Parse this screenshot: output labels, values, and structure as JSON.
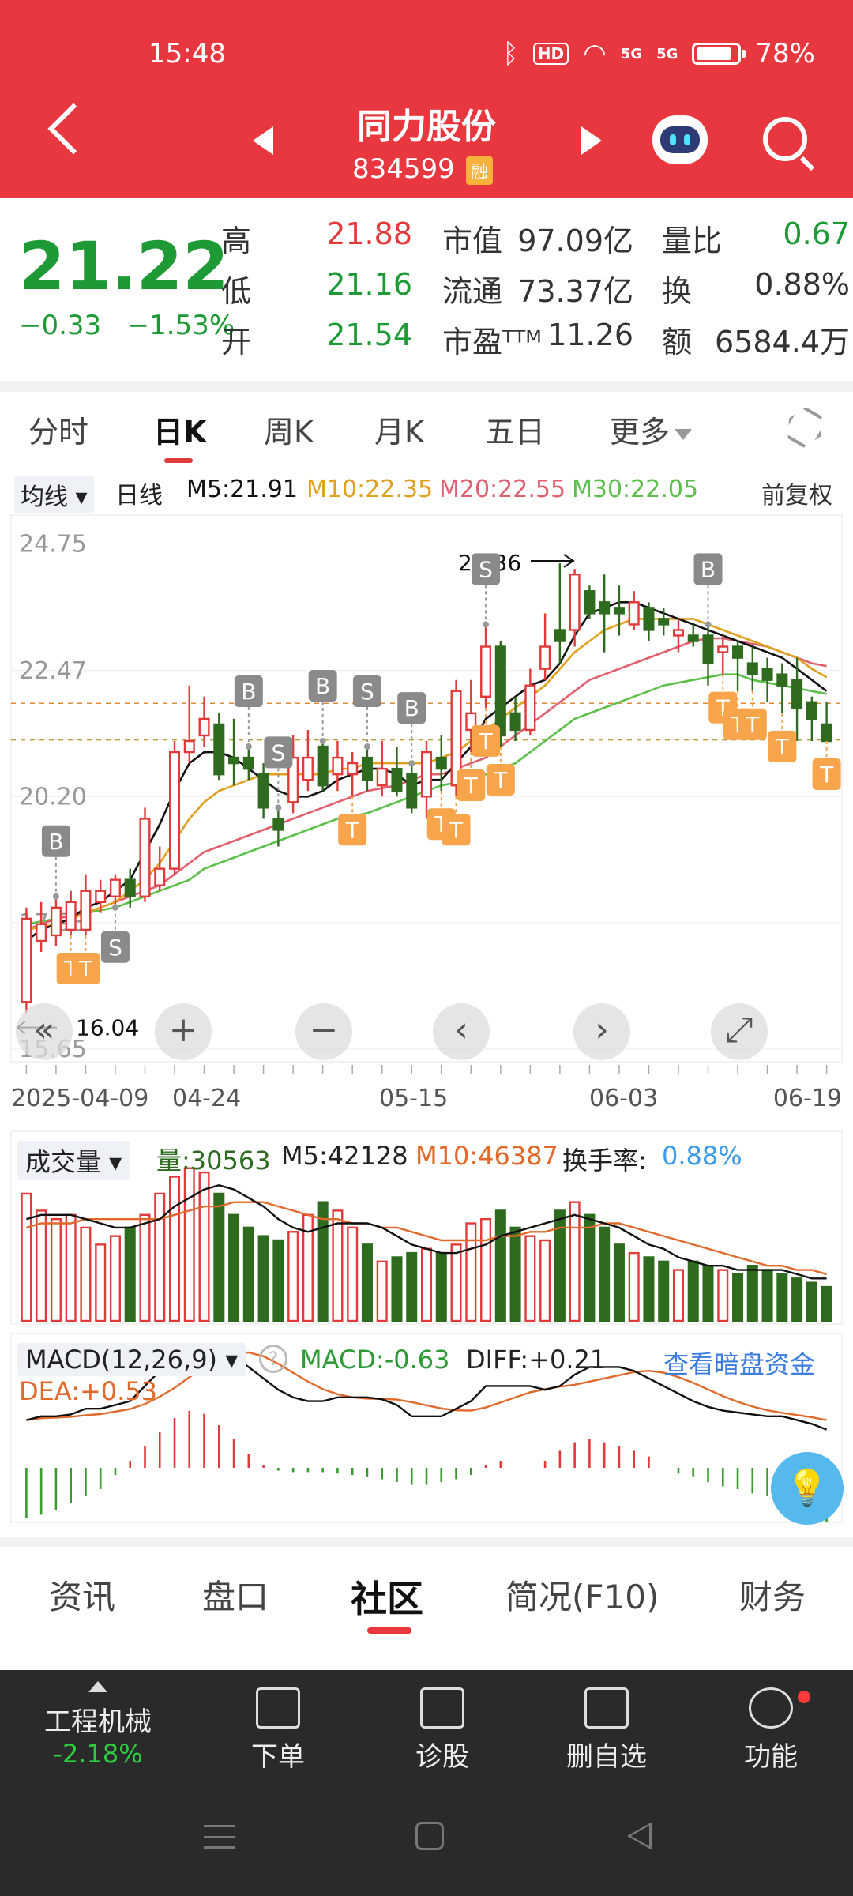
{
  "status_bar": {
    "time": "15:48",
    "hd": "HD",
    "sig1": "5G",
    "sig2": "5G",
    "battery": "78%"
  },
  "header": {
    "name": "同力股份",
    "code": "834599",
    "badge": "融"
  },
  "quote": {
    "price": "21.22",
    "change": "−0.33",
    "change_pct": "−1.53%",
    "rows": [
      {
        "l1": "高",
        "v1": "21.88",
        "l2": "市值",
        "v2": "97.09亿",
        "l3": "量比",
        "v3": "0.67"
      },
      {
        "l1": "低",
        "v1": "21.16",
        "l2": "流通",
        "v2": "73.37亿",
        "l3": "换",
        "v3": "0.88%"
      },
      {
        "l1": "开",
        "v1": "21.54",
        "l2": "市盈ᵀᵀᴹ",
        "v2": "11.26",
        "l3": "额",
        "v3": "6584.4万"
      }
    ]
  },
  "tabs": {
    "t1": "分时",
    "t2": "日K",
    "t3": "周K",
    "t4": "月K",
    "t5": "五日",
    "t6": "更多"
  },
  "legend": {
    "junxian": "均线 ▾",
    "rixian": "日线",
    "m5": "M5:21.91",
    "m10": "M10:22.35",
    "m20": "M20:22.55",
    "m30": "M30:22.05",
    "fq": "前复权"
  },
  "colors": {
    "red": "#e13a3a",
    "green": "#2e6b1f",
    "m5": "#111111",
    "m10": "#e0a020",
    "m20": "#e06070",
    "m30": "#5cbf4a",
    "marker_t": "#f7a44a",
    "marker_bs": "#8a8a8a"
  },
  "chart_data": {
    "type": "candlestick",
    "y_axis_labels": [
      "24.75",
      "22.47",
      "20.20",
      "17.93",
      "15.65"
    ],
    "high_label": "24.36",
    "low_label": "16.04",
    "x_labels": [
      "2025-04-09",
      "04-24",
      "05-15",
      "06-03",
      "06-19"
    ],
    "candles": [
      {
        "o": 16.5,
        "c": 18.0,
        "h": 18.2,
        "l": 16.3
      },
      {
        "o": 17.6,
        "c": 17.9,
        "h": 18.3,
        "l": 17.4
      },
      {
        "o": 17.7,
        "c": 18.2,
        "h": 18.4,
        "l": 17.5
      },
      {
        "o": 17.8,
        "c": 18.3,
        "h": 18.5,
        "l": 17.7
      },
      {
        "o": 17.8,
        "c": 18.5,
        "h": 18.8,
        "l": 17.7
      },
      {
        "o": 18.3,
        "c": 18.5,
        "h": 18.7,
        "l": 18.1
      },
      {
        "o": 18.4,
        "c": 18.7,
        "h": 18.8,
        "l": 18.2
      },
      {
        "o": 18.7,
        "c": 18.4,
        "h": 18.9,
        "l": 18.2
      },
      {
        "o": 18.4,
        "c": 19.8,
        "h": 20.0,
        "l": 18.3
      },
      {
        "o": 18.6,
        "c": 18.9,
        "h": 19.3,
        "l": 18.5
      },
      {
        "o": 18.9,
        "c": 21.0,
        "h": 21.2,
        "l": 18.8
      },
      {
        "o": 21.0,
        "c": 21.2,
        "h": 22.2,
        "l": 20.8
      },
      {
        "o": 21.3,
        "c": 21.6,
        "h": 22.0,
        "l": 21.1
      },
      {
        "o": 21.5,
        "c": 20.6,
        "h": 21.7,
        "l": 20.5
      },
      {
        "o": 20.9,
        "c": 20.8,
        "h": 21.6,
        "l": 20.4
      },
      {
        "o": 20.9,
        "c": 20.7,
        "h": 21.1,
        "l": 20.5
      },
      {
        "o": 20.6,
        "c": 20.0,
        "h": 20.8,
        "l": 19.8
      },
      {
        "o": 19.8,
        "c": 19.6,
        "h": 20.0,
        "l": 19.3
      },
      {
        "o": 20.1,
        "c": 20.9,
        "h": 21.3,
        "l": 19.9
      },
      {
        "o": 20.5,
        "c": 20.9,
        "h": 21.4,
        "l": 20.3
      },
      {
        "o": 21.1,
        "c": 20.4,
        "h": 21.2,
        "l": 20.3
      },
      {
        "o": 20.6,
        "c": 20.9,
        "h": 21.2,
        "l": 20.3
      },
      {
        "o": 20.6,
        "c": 20.8,
        "h": 21.0,
        "l": 20.2
      },
      {
        "o": 20.9,
        "c": 20.5,
        "h": 21.1,
        "l": 20.3
      },
      {
        "o": 20.4,
        "c": 20.7,
        "h": 21.2,
        "l": 20.2
      },
      {
        "o": 20.7,
        "c": 20.3,
        "h": 21.1,
        "l": 20.2
      },
      {
        "o": 20.6,
        "c": 20.0,
        "h": 20.8,
        "l": 19.9
      },
      {
        "o": 20.2,
        "c": 21.0,
        "h": 21.2,
        "l": 19.8
      },
      {
        "o": 20.9,
        "c": 20.7,
        "h": 21.3,
        "l": 20.3
      },
      {
        "o": 20.4,
        "c": 22.1,
        "h": 22.3,
        "l": 20.2
      },
      {
        "o": 21.4,
        "c": 21.7,
        "h": 22.3,
        "l": 21.0
      },
      {
        "o": 22.0,
        "c": 22.9,
        "h": 23.3,
        "l": 21.8
      },
      {
        "o": 22.9,
        "c": 21.3,
        "h": 23.0,
        "l": 21.1
      },
      {
        "o": 21.7,
        "c": 21.4,
        "h": 22.0,
        "l": 21.2
      },
      {
        "o": 21.4,
        "c": 22.2,
        "h": 22.5,
        "l": 21.3
      },
      {
        "o": 22.5,
        "c": 22.9,
        "h": 23.5,
        "l": 22.3
      },
      {
        "o": 23.2,
        "c": 23.0,
        "h": 24.4,
        "l": 22.6
      },
      {
        "o": 23.2,
        "c": 24.2,
        "h": 24.3,
        "l": 22.9
      },
      {
        "o": 23.9,
        "c": 23.5,
        "h": 24.0,
        "l": 23.4
      },
      {
        "o": 23.7,
        "c": 23.5,
        "h": 24.2,
        "l": 22.8
      },
      {
        "o": 23.6,
        "c": 23.5,
        "h": 24.0,
        "l": 23.1
      },
      {
        "o": 23.3,
        "c": 23.7,
        "h": 23.9,
        "l": 23.2
      },
      {
        "o": 23.6,
        "c": 23.2,
        "h": 23.7,
        "l": 23.0
      },
      {
        "o": 23.4,
        "c": 23.3,
        "h": 23.6,
        "l": 23.1
      },
      {
        "o": 23.1,
        "c": 23.2,
        "h": 23.4,
        "l": 22.8
      },
      {
        "o": 23.1,
        "c": 23.0,
        "h": 23.3,
        "l": 22.9
      },
      {
        "o": 23.1,
        "c": 22.6,
        "h": 23.3,
        "l": 22.2
      },
      {
        "o": 22.8,
        "c": 22.9,
        "h": 23.1,
        "l": 22.4
      },
      {
        "o": 22.9,
        "c": 22.7,
        "h": 23.0,
        "l": 22.1
      },
      {
        "o": 22.6,
        "c": 22.4,
        "h": 22.9,
        "l": 22.1
      },
      {
        "o": 22.5,
        "c": 22.3,
        "h": 22.7,
        "l": 21.9
      },
      {
        "o": 22.4,
        "c": 22.2,
        "h": 22.6,
        "l": 21.7
      },
      {
        "o": 22.3,
        "c": 21.8,
        "h": 22.7,
        "l": 21.2
      },
      {
        "o": 21.9,
        "c": 21.6,
        "h": 22.0,
        "l": 21.2
      },
      {
        "o": 21.5,
        "c": 21.2,
        "h": 21.9,
        "l": 21.2
      }
    ],
    "ma5": [
      17.6,
      17.8,
      17.9,
      18.0,
      18.2,
      18.3,
      18.5,
      18.7,
      19.2,
      19.7,
      20.3,
      20.8,
      21.0,
      21.0,
      20.9,
      20.7,
      20.5,
      20.3,
      20.2,
      20.2,
      20.3,
      20.5,
      20.6,
      20.7,
      20.7,
      20.6,
      20.4,
      20.5,
      20.5,
      20.8,
      21.1,
      21.6,
      21.8,
      22.0,
      22.2,
      22.3,
      22.6,
      23.1,
      23.5,
      23.6,
      23.7,
      23.7,
      23.6,
      23.5,
      23.4,
      23.3,
      23.2,
      23.1,
      23.0,
      22.9,
      22.8,
      22.7,
      22.5,
      22.3,
      22.1
    ],
    "ma10": [
      17.8,
      17.85,
      17.9,
      18.0,
      18.1,
      18.2,
      18.3,
      18.5,
      18.7,
      19.0,
      19.4,
      19.8,
      20.1,
      20.3,
      20.4,
      20.5,
      20.6,
      20.6,
      20.6,
      20.6,
      20.6,
      20.7,
      20.7,
      20.8,
      20.8,
      20.8,
      20.8,
      20.8,
      20.9,
      21.0,
      21.2,
      21.4,
      21.6,
      21.8,
      22.0,
      22.2,
      22.5,
      22.8,
      23.0,
      23.2,
      23.3,
      23.4,
      23.4,
      23.4,
      23.4,
      23.4,
      23.3,
      23.2,
      23.1,
      23.0,
      22.9,
      22.8,
      22.7,
      22.5,
      22.35
    ],
    "ma20": [
      17.8,
      17.9,
      18.0,
      18.05,
      18.1,
      18.2,
      18.3,
      18.4,
      18.5,
      18.6,
      18.8,
      19.0,
      19.2,
      19.3,
      19.4,
      19.5,
      19.6,
      19.7,
      19.8,
      19.9,
      20.0,
      20.1,
      20.2,
      20.3,
      20.35,
      20.4,
      20.5,
      20.6,
      20.6,
      20.7,
      20.8,
      20.9,
      21.1,
      21.3,
      21.5,
      21.7,
      21.9,
      22.1,
      22.3,
      22.4,
      22.5,
      22.6,
      22.7,
      22.8,
      22.9,
      23.0,
      23.05,
      23.05,
      23.0,
      22.95,
      22.9,
      22.8,
      22.7,
      22.6,
      22.55
    ],
    "ma30": [
      17.9,
      17.95,
      18.0,
      18.05,
      18.1,
      18.15,
      18.2,
      18.3,
      18.4,
      18.5,
      18.6,
      18.7,
      18.9,
      19.0,
      19.1,
      19.2,
      19.3,
      19.4,
      19.5,
      19.6,
      19.7,
      19.8,
      19.85,
      19.9,
      20.0,
      20.1,
      20.2,
      20.3,
      20.4,
      20.45,
      20.5,
      20.6,
      20.7,
      20.8,
      21.0,
      21.2,
      21.4,
      21.6,
      21.7,
      21.8,
      21.9,
      22.0,
      22.1,
      22.2,
      22.25,
      22.3,
      22.35,
      22.4,
      22.4,
      22.3,
      22.25,
      22.2,
      22.15,
      22.1,
      22.05
    ],
    "volume": [
      30,
      26,
      24,
      25,
      22,
      18,
      20,
      22,
      25,
      30,
      34,
      36,
      35,
      30,
      25,
      22,
      20,
      19,
      21,
      25,
      28,
      26,
      22,
      18,
      14,
      15,
      16,
      17,
      16,
      18,
      23,
      24,
      26,
      22,
      20,
      19,
      26,
      28,
      25,
      22,
      18,
      16,
      15,
      14,
      12,
      14,
      13,
      12,
      11,
      13,
      12,
      11,
      10,
      9,
      8
    ],
    "vol_ma5": [
      24,
      25,
      25,
      25,
      24,
      23,
      22,
      22,
      23,
      24,
      27,
      29,
      31,
      32,
      31,
      29,
      27,
      24,
      22,
      21,
      22,
      23,
      23,
      23,
      22,
      20,
      18,
      17,
      16,
      16,
      17,
      18,
      20,
      21,
      22,
      23,
      24,
      25,
      24,
      23,
      22,
      20,
      18,
      17,
      15,
      14,
      13,
      13,
      12,
      12,
      12,
      12,
      11,
      10,
      10
    ],
    "vol_ma10": [
      22,
      23,
      23,
      23,
      24,
      24,
      24,
      24,
      24,
      24,
      25,
      26,
      27,
      27,
      28,
      28,
      28,
      27,
      26,
      25,
      24,
      24,
      23,
      23,
      22,
      22,
      21,
      20,
      19,
      19,
      19,
      19,
      20,
      20,
      21,
      21,
      22,
      22,
      22,
      23,
      23,
      22,
      21,
      20,
      19,
      18,
      17,
      16,
      15,
      14,
      13,
      13,
      12,
      12,
      11
    ],
    "macd_bars": [
      -0.35,
      -0.33,
      -0.3,
      -0.25,
      -0.2,
      -0.15,
      -0.05,
      0.05,
      0.15,
      0.25,
      0.35,
      0.4,
      0.38,
      0.3,
      0.2,
      0.1,
      0.02,
      -0.02,
      -0.03,
      -0.03,
      -0.03,
      -0.04,
      -0.05,
      -0.06,
      -0.08,
      -0.1,
      -0.12,
      -0.12,
      -0.1,
      -0.08,
      -0.05,
      0.02,
      0.05,
      0.0,
      0.0,
      0.05,
      0.12,
      0.18,
      0.2,
      0.18,
      0.15,
      0.12,
      0.08,
      0.0,
      -0.04,
      -0.06,
      -0.1,
      -0.13,
      -0.15,
      -0.18,
      -0.2,
      -0.25,
      -0.3,
      -0.35,
      -0.38
    ]
  },
  "markers": [
    {
      "i": 2,
      "t": "B",
      "up": true
    },
    {
      "i": 6,
      "t": "S",
      "up": false
    },
    {
      "i": 15,
      "t": "B",
      "up": true
    },
    {
      "i": 17,
      "t": "S",
      "up": true
    },
    {
      "i": 20,
      "t": "B",
      "up": true
    },
    {
      "i": 23,
      "t": "S",
      "up": true
    },
    {
      "i": 26,
      "t": "B",
      "up": true
    },
    {
      "i": 31,
      "t": "S",
      "up": true
    },
    {
      "i": 46,
      "t": "B",
      "up": true
    }
  ],
  "t_markers": [
    3,
    4,
    22,
    28,
    29,
    30,
    31,
    32,
    47,
    48,
    49,
    51,
    54
  ],
  "vol_legend": {
    "name": "成交量 ▾",
    "vol": "量:30563",
    "m5": "M5:42128",
    "m10": "M10:46387",
    "turn_label": "换手率:",
    "turn_val": "0.88%"
  },
  "macd_legend": {
    "name": "MACD(12,26,9) ▾",
    "help": "?",
    "macd": "MACD:-0.63",
    "diff": "DIFF:+0.21",
    "link": "查看暗盘资金",
    "dea": "DEA:+0.53"
  },
  "controls": {
    "back": "«",
    "plus": "+",
    "minus": "−",
    "left": "‹",
    "right": "›",
    "full": "⤢"
  },
  "btabs": {
    "t1": "资讯",
    "t2": "盘口",
    "t3": "社区",
    "t4": "简况(F10)",
    "t5": "财务"
  },
  "bottombar": {
    "sector": "工程机械",
    "sector_chg": "-2.18%",
    "order": "下单",
    "diag": "诊股",
    "del": "删自选",
    "func": "功能"
  },
  "bulb": "💡"
}
